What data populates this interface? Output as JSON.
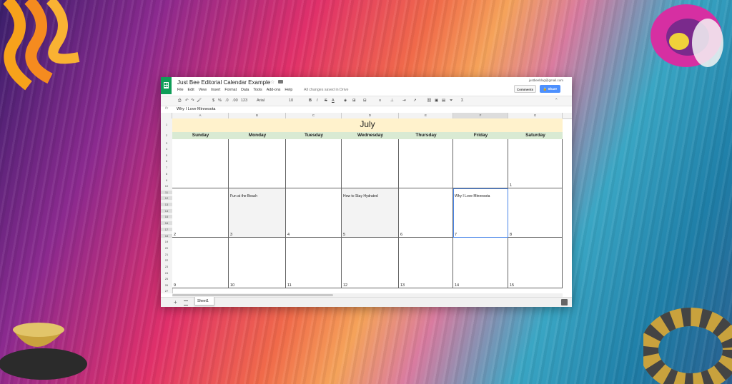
{
  "colors": {
    "sheets_green": "#0f9d58",
    "month_band": "#fff2cc",
    "day_band": "#d9ead3",
    "share_blue": "#4d90fe",
    "selection": "#4a86e8"
  },
  "window": {
    "doc_title": "Just Bee Editorial Calendar Example",
    "menu": [
      "File",
      "Edit",
      "View",
      "Insert",
      "Format",
      "Data",
      "Tools",
      "Add-ons",
      "Help"
    ],
    "save_status": "All changes saved in Drive",
    "account": "justbeeblog@gmail.com",
    "comments_label": "Comments",
    "share_label": "Share"
  },
  "toolbar": {
    "zoom": "123",
    "font": "Arial",
    "font_size": "10",
    "bold": "B",
    "italic": "I",
    "strike": "S",
    "text_color": "A",
    "sigma": "Σ"
  },
  "formula": {
    "fx": "fx",
    "value": "Why I Love Minnesota"
  },
  "columns": [
    "A",
    "B",
    "C",
    "D",
    "E",
    "F",
    "G"
  ],
  "rows": [
    "1",
    "2",
    "3",
    "4",
    "5",
    "6",
    "7",
    "8",
    "9",
    "10",
    "11",
    "12",
    "13",
    "14",
    "15",
    "16",
    "17",
    "18",
    "19",
    "20",
    "21",
    "22",
    "23",
    "24",
    "25",
    "26",
    "27"
  ],
  "calendar": {
    "month": "July",
    "days": [
      "Sunday",
      "Monday",
      "Tuesday",
      "Wednesday",
      "Thursday",
      "Friday",
      "Saturday"
    ],
    "week1": [
      "",
      "",
      "",
      "",
      "",
      "",
      "1"
    ],
    "week2": [
      "2",
      "3",
      "4",
      "5",
      "6",
      "7",
      "8"
    ],
    "week2_events": [
      "",
      "Fun at the Beach",
      "",
      "How to Stay Hydrated",
      "",
      "Why I Love Minnesota",
      ""
    ],
    "week3": [
      "9",
      "10",
      "11",
      "12",
      "13",
      "14",
      "15"
    ]
  },
  "sheet_tab": "Sheet1"
}
